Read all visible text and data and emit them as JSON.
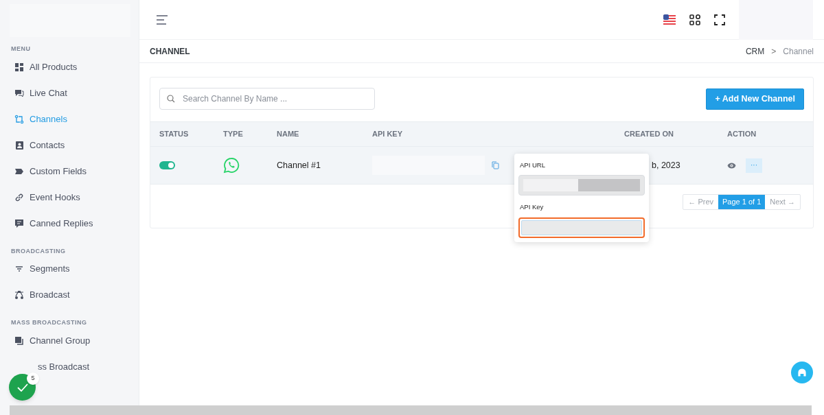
{
  "sidebar": {
    "sections": [
      {
        "title": "MENU",
        "items": [
          {
            "label": "All Products",
            "selected": false
          },
          {
            "label": "Live Chat",
            "selected": false
          },
          {
            "label": "Channels",
            "selected": true
          },
          {
            "label": "Contacts",
            "selected": false
          },
          {
            "label": "Custom Fields",
            "selected": false
          },
          {
            "label": "Event Hooks",
            "selected": false
          },
          {
            "label": "Canned Replies",
            "selected": false
          }
        ]
      },
      {
        "title": "BROADCASTING",
        "items": [
          {
            "label": "Segments",
            "selected": false
          },
          {
            "label": "Broadcast",
            "selected": false
          }
        ]
      },
      {
        "title": "MASS BROADCASTING",
        "items": [
          {
            "label": "Channel Group",
            "selected": false
          },
          {
            "label": "ss Broadcast",
            "selected": false
          }
        ]
      }
    ]
  },
  "floating_badge": {
    "count": "5"
  },
  "page_title": "CHANNEL",
  "breadcrumb": [
    "CRM",
    "Channel"
  ],
  "breadcrumb_separator": ">",
  "search": {
    "placeholder": "Search Channel By Name ..."
  },
  "add_button": "+ Add New Channel",
  "table": {
    "columns": [
      "STATUS",
      "TYPE",
      "NAME",
      "API KEY",
      "CREATED ON",
      "ACTION"
    ],
    "rows": [
      {
        "on": true,
        "name": "Channel #1",
        "created_on": "b, 2023",
        "action": "···"
      }
    ]
  },
  "popover": {
    "fields": [
      {
        "label": "API URL",
        "focused": false
      },
      {
        "label": "API Key",
        "focused": true
      }
    ]
  },
  "pagination": {
    "prev": "← Prev",
    "pages": [
      {
        "label": "Page 1 of 1",
        "selected": true
      }
    ],
    "next": "Next →"
  }
}
